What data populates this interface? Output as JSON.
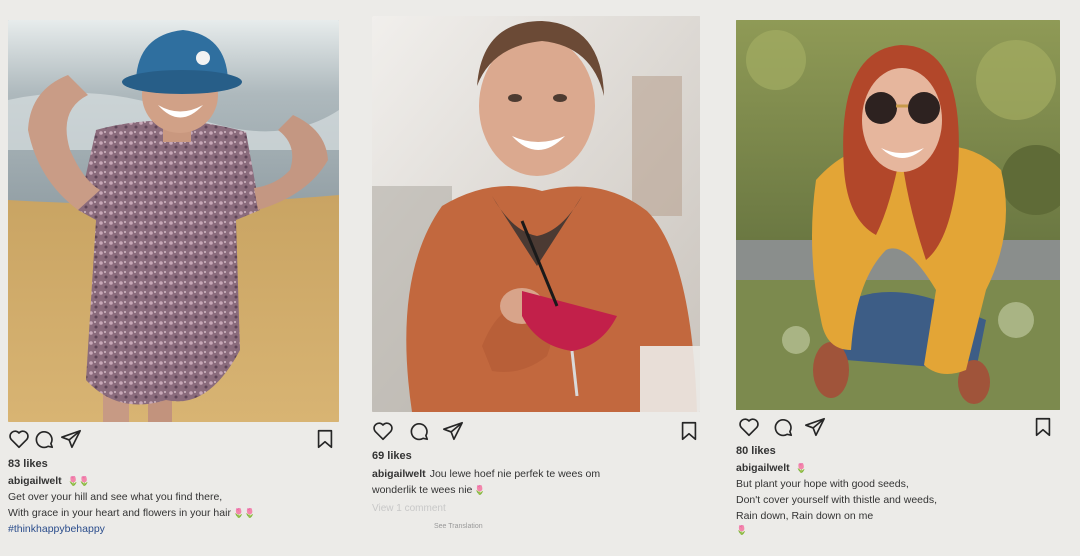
{
  "posts": [
    {
      "likes": "83 likes",
      "username": "abigailwelt",
      "username_emoji": "🌷🌷",
      "caption_lines": [
        "Get over your hill and see what you find there,",
        "With grace in your heart and flowers in your hair"
      ],
      "caption_line2_emoji": "🌷🌷",
      "hashtag": "#thinkhappybehappy",
      "photo_alt": "Smiling woman in a floral dress and blue bucket hat on a beach"
    },
    {
      "likes": "69 likes",
      "username": "abigailwelt",
      "caption_inline": "Jou lewe hoef nie perfek te wees om",
      "caption_line2": "wonderlik te wees nie",
      "caption_line2_emoji": "🌷",
      "faint_text": "View 1 comment",
      "see_translation": "See Translation",
      "photo_alt": "Smiling woman in an orange cardigan holding a cocktail glass"
    },
    {
      "likes": "80 likes",
      "username": "abigailwelt",
      "username_emoji": "🌷",
      "caption_lines": [
        "But plant your hope with good seeds,",
        "Don't cover yourself with thistle and weeds,",
        "Rain down, Rain down on me"
      ],
      "caption_tail_emoji": "🌷",
      "photo_alt": "Smiling woman with red hair and sunglasses in a yellow cardigan"
    }
  ],
  "icons": [
    "heart-icon",
    "comment-icon",
    "share-icon",
    "bookmark-icon"
  ],
  "colors": {
    "text": "#262626",
    "hashtag": "#2b4d8c",
    "background": "#ecebe8"
  }
}
